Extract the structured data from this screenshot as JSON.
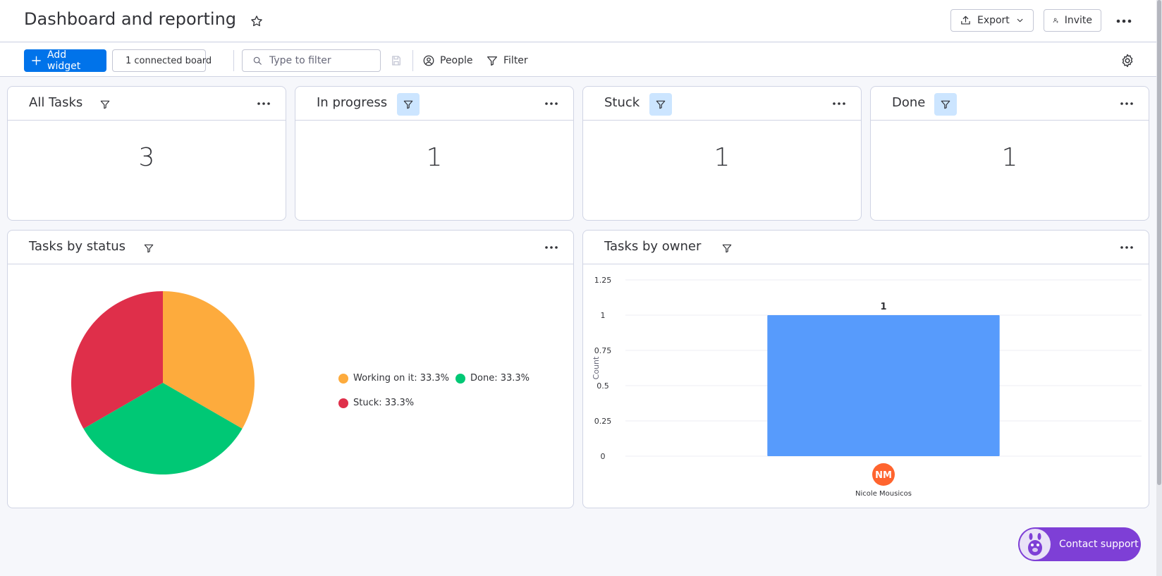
{
  "header": {
    "title": "Dashboard and reporting",
    "export_label": "Export",
    "invite_label": "Invite"
  },
  "toolbar": {
    "add_widget_label": "Add widget",
    "connected_board_label": "1 connected board",
    "filter_placeholder": "Type to filter",
    "people_label": "People",
    "filter_label": "Filter"
  },
  "cards": [
    {
      "title": "All Tasks",
      "value": "3",
      "filter_active": false
    },
    {
      "title": "In progress",
      "value": "1",
      "filter_active": true
    },
    {
      "title": "Stuck",
      "value": "1",
      "filter_active": true
    },
    {
      "title": "Done",
      "value": "1",
      "filter_active": true
    }
  ],
  "status_widget": {
    "title": "Tasks by status",
    "legend": [
      {
        "label": "Working on it: 33.3%",
        "color": "#fdab3d"
      },
      {
        "label": "Done: 33.3%",
        "color": "#00c875"
      },
      {
        "label": "Stuck: 33.3%",
        "color": "#df2f4a"
      }
    ]
  },
  "owner_widget": {
    "title": "Tasks by owner",
    "ylabel": "Count",
    "owner_initials": "NM",
    "owner_name": "Nicole Mousicos"
  },
  "chart_data": [
    {
      "type": "pie",
      "title": "Tasks by status",
      "categories": [
        "Working on it",
        "Done",
        "Stuck"
      ],
      "values": [
        33.3,
        33.3,
        33.3
      ],
      "colors": [
        "#fdab3d",
        "#00c875",
        "#df2f4a"
      ],
      "legend": "right"
    },
    {
      "type": "bar",
      "title": "Tasks by owner",
      "categories": [
        "Nicole Mousicos"
      ],
      "values": [
        1
      ],
      "ylabel": "Count",
      "ylim": [
        0,
        1.25
      ],
      "yticks": [
        "0",
        "0.25",
        "0.5",
        "0.75",
        "1",
        "1.25"
      ],
      "data_labels": [
        "1"
      ],
      "color": "#579bfc",
      "grid": true
    }
  ],
  "support": {
    "label": "Contact support"
  },
  "colors": {
    "primary": "#0073ea",
    "filter_active_bg": "#cce5ff",
    "owner_avatar": "#ff642e",
    "support_bg": "#7e3fd6"
  }
}
